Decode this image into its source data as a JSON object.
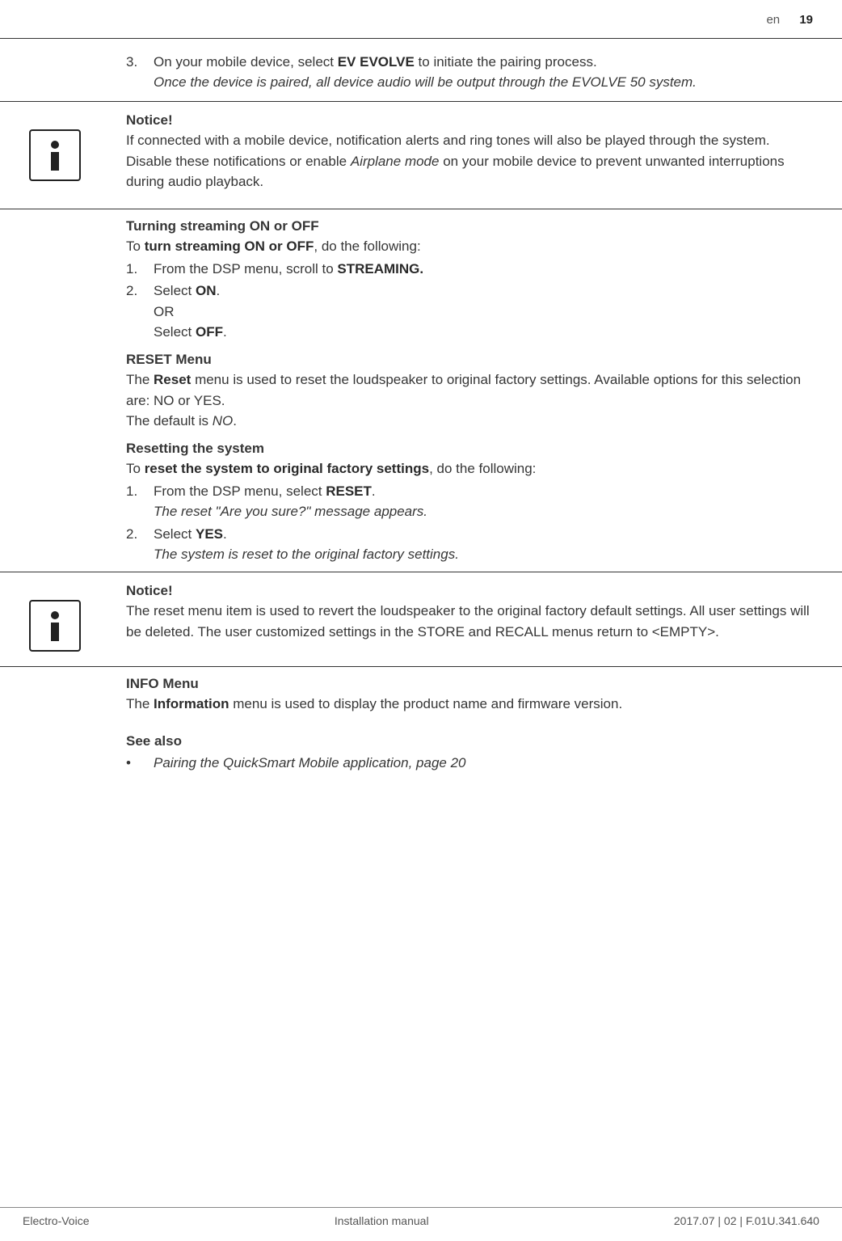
{
  "header": {
    "lang": "en",
    "page": "19"
  },
  "step3": {
    "num": "3.",
    "line_a": "On your mobile device, select ",
    "line_a_bold": "EV EVOLVE",
    "line_a_post": " to initiate the pairing process.",
    "line_b": "Once the device is paired, all device audio will be output through the EVOLVE 50 system."
  },
  "notice1": {
    "title": "Notice!",
    "p1": "If connected with a mobile device, notification alerts and ring tones will also be played through the system.",
    "p2a": "Disable these notifications or enable ",
    "p2i": "Airplane mode",
    "p2b": " on your mobile device to prevent unwanted interruptions during audio playback."
  },
  "stream": {
    "title": "Turning streaming ON or OFF",
    "intro_a": "To ",
    "intro_b": "turn streaming ON or OFF",
    "intro_c": ", do the following:",
    "s1n": "1.",
    "s1a": "From the DSP menu, scroll to ",
    "s1b": "STREAMING.",
    "s2n": "2.",
    "s2a": "Select ",
    "s2b": "ON",
    "s2c": ".",
    "s2or": "OR",
    "s2d": "Select ",
    "s2e": "OFF",
    "s2f": "."
  },
  "reset": {
    "title": "RESET Menu",
    "p1a": "The ",
    "p1b": "Reset",
    "p1c": " menu is used to reset the loudspeaker to original factory settings. Available options for this selection are: NO or YES.",
    "p2a": "The default is ",
    "p2i": "NO",
    "p2b": "."
  },
  "resetting": {
    "title": "Resetting the system",
    "intro_a": "To ",
    "intro_b": "reset the system to original factory settings",
    "intro_c": ", do the following:",
    "s1n": "1.",
    "s1a": "From the DSP menu, select ",
    "s1b": "RESET",
    "s1c": ".",
    "s1i": "The reset \"Are you sure?\" message appears.",
    "s2n": "2.",
    "s2a": "Select ",
    "s2b": "YES",
    "s2c": ".",
    "s2i": "The system is reset to the original factory settings."
  },
  "notice2": {
    "title": "Notice!",
    "p": "The reset menu item is used to revert the loudspeaker to the original factory default settings. All user settings will be deleted. The user customized settings in the STORE and RECALL menus return to <EMPTY>."
  },
  "info": {
    "title": "INFO Menu",
    "p_a": "The ",
    "p_b": "Information",
    "p_c": " menu is used to display the product name and firmware version."
  },
  "seealso": {
    "title": "See also",
    "bullet": "•",
    "item": "Pairing the QuickSmart Mobile application, page 20"
  },
  "footer": {
    "left": "Electro-Voice",
    "center": "Installation manual",
    "right": "2017.07 | 02 | F.01U.341.640"
  }
}
